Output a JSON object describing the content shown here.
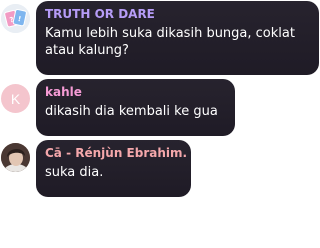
{
  "messages": [
    {
      "sender": "TRUTH OR DARE",
      "sender_color": "#b69cf7",
      "avatar_icon": "playing-cards-icon",
      "text": "Kamu lebih suka dikasih bunga, coklat atau kalung?"
    },
    {
      "sender": "kahle",
      "sender_color": "#f59bd5",
      "avatar_letter": "K",
      "text": "dikasih dia kembali ke gua"
    },
    {
      "sender": "Cā - Rénjùn Ebrahim.",
      "sender_color": "#f4a7ab",
      "avatar_icon": "user-photo-avatar",
      "text": "suka dia."
    }
  ]
}
